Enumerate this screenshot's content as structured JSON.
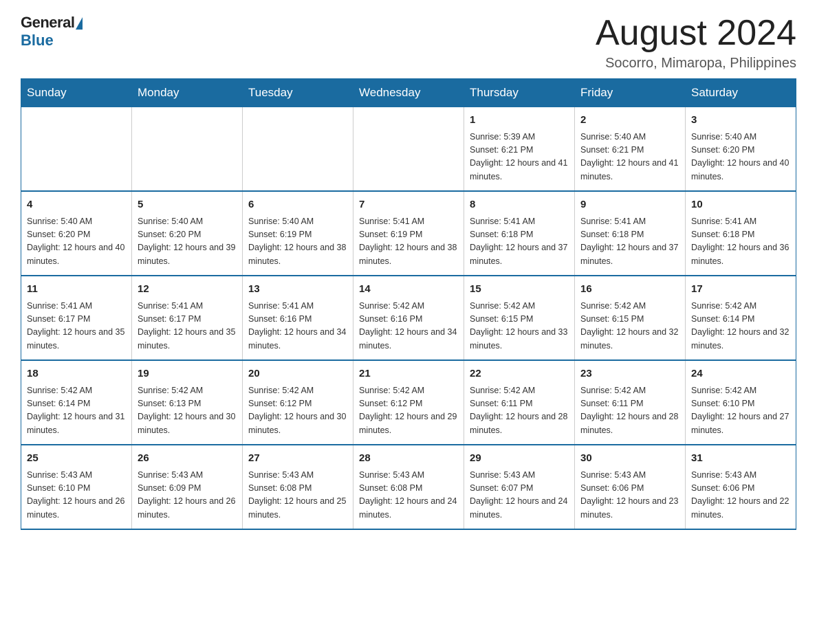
{
  "logo": {
    "general": "General",
    "blue": "Blue"
  },
  "title": "August 2024",
  "subtitle": "Socorro, Mimaropa, Philippines",
  "days_of_week": [
    "Sunday",
    "Monday",
    "Tuesday",
    "Wednesday",
    "Thursday",
    "Friday",
    "Saturday"
  ],
  "weeks": [
    [
      {
        "day": "",
        "info": ""
      },
      {
        "day": "",
        "info": ""
      },
      {
        "day": "",
        "info": ""
      },
      {
        "day": "",
        "info": ""
      },
      {
        "day": "1",
        "info": "Sunrise: 5:39 AM\nSunset: 6:21 PM\nDaylight: 12 hours and 41 minutes."
      },
      {
        "day": "2",
        "info": "Sunrise: 5:40 AM\nSunset: 6:21 PM\nDaylight: 12 hours and 41 minutes."
      },
      {
        "day": "3",
        "info": "Sunrise: 5:40 AM\nSunset: 6:20 PM\nDaylight: 12 hours and 40 minutes."
      }
    ],
    [
      {
        "day": "4",
        "info": "Sunrise: 5:40 AM\nSunset: 6:20 PM\nDaylight: 12 hours and 40 minutes."
      },
      {
        "day": "5",
        "info": "Sunrise: 5:40 AM\nSunset: 6:20 PM\nDaylight: 12 hours and 39 minutes."
      },
      {
        "day": "6",
        "info": "Sunrise: 5:40 AM\nSunset: 6:19 PM\nDaylight: 12 hours and 38 minutes."
      },
      {
        "day": "7",
        "info": "Sunrise: 5:41 AM\nSunset: 6:19 PM\nDaylight: 12 hours and 38 minutes."
      },
      {
        "day": "8",
        "info": "Sunrise: 5:41 AM\nSunset: 6:18 PM\nDaylight: 12 hours and 37 minutes."
      },
      {
        "day": "9",
        "info": "Sunrise: 5:41 AM\nSunset: 6:18 PM\nDaylight: 12 hours and 37 minutes."
      },
      {
        "day": "10",
        "info": "Sunrise: 5:41 AM\nSunset: 6:18 PM\nDaylight: 12 hours and 36 minutes."
      }
    ],
    [
      {
        "day": "11",
        "info": "Sunrise: 5:41 AM\nSunset: 6:17 PM\nDaylight: 12 hours and 35 minutes."
      },
      {
        "day": "12",
        "info": "Sunrise: 5:41 AM\nSunset: 6:17 PM\nDaylight: 12 hours and 35 minutes."
      },
      {
        "day": "13",
        "info": "Sunrise: 5:41 AM\nSunset: 6:16 PM\nDaylight: 12 hours and 34 minutes."
      },
      {
        "day": "14",
        "info": "Sunrise: 5:42 AM\nSunset: 6:16 PM\nDaylight: 12 hours and 34 minutes."
      },
      {
        "day": "15",
        "info": "Sunrise: 5:42 AM\nSunset: 6:15 PM\nDaylight: 12 hours and 33 minutes."
      },
      {
        "day": "16",
        "info": "Sunrise: 5:42 AM\nSunset: 6:15 PM\nDaylight: 12 hours and 32 minutes."
      },
      {
        "day": "17",
        "info": "Sunrise: 5:42 AM\nSunset: 6:14 PM\nDaylight: 12 hours and 32 minutes."
      }
    ],
    [
      {
        "day": "18",
        "info": "Sunrise: 5:42 AM\nSunset: 6:14 PM\nDaylight: 12 hours and 31 minutes."
      },
      {
        "day": "19",
        "info": "Sunrise: 5:42 AM\nSunset: 6:13 PM\nDaylight: 12 hours and 30 minutes."
      },
      {
        "day": "20",
        "info": "Sunrise: 5:42 AM\nSunset: 6:12 PM\nDaylight: 12 hours and 30 minutes."
      },
      {
        "day": "21",
        "info": "Sunrise: 5:42 AM\nSunset: 6:12 PM\nDaylight: 12 hours and 29 minutes."
      },
      {
        "day": "22",
        "info": "Sunrise: 5:42 AM\nSunset: 6:11 PM\nDaylight: 12 hours and 28 minutes."
      },
      {
        "day": "23",
        "info": "Sunrise: 5:42 AM\nSunset: 6:11 PM\nDaylight: 12 hours and 28 minutes."
      },
      {
        "day": "24",
        "info": "Sunrise: 5:42 AM\nSunset: 6:10 PM\nDaylight: 12 hours and 27 minutes."
      }
    ],
    [
      {
        "day": "25",
        "info": "Sunrise: 5:43 AM\nSunset: 6:10 PM\nDaylight: 12 hours and 26 minutes."
      },
      {
        "day": "26",
        "info": "Sunrise: 5:43 AM\nSunset: 6:09 PM\nDaylight: 12 hours and 26 minutes."
      },
      {
        "day": "27",
        "info": "Sunrise: 5:43 AM\nSunset: 6:08 PM\nDaylight: 12 hours and 25 minutes."
      },
      {
        "day": "28",
        "info": "Sunrise: 5:43 AM\nSunset: 6:08 PM\nDaylight: 12 hours and 24 minutes."
      },
      {
        "day": "29",
        "info": "Sunrise: 5:43 AM\nSunset: 6:07 PM\nDaylight: 12 hours and 24 minutes."
      },
      {
        "day": "30",
        "info": "Sunrise: 5:43 AM\nSunset: 6:06 PM\nDaylight: 12 hours and 23 minutes."
      },
      {
        "day": "31",
        "info": "Sunrise: 5:43 AM\nSunset: 6:06 PM\nDaylight: 12 hours and 22 minutes."
      }
    ]
  ]
}
